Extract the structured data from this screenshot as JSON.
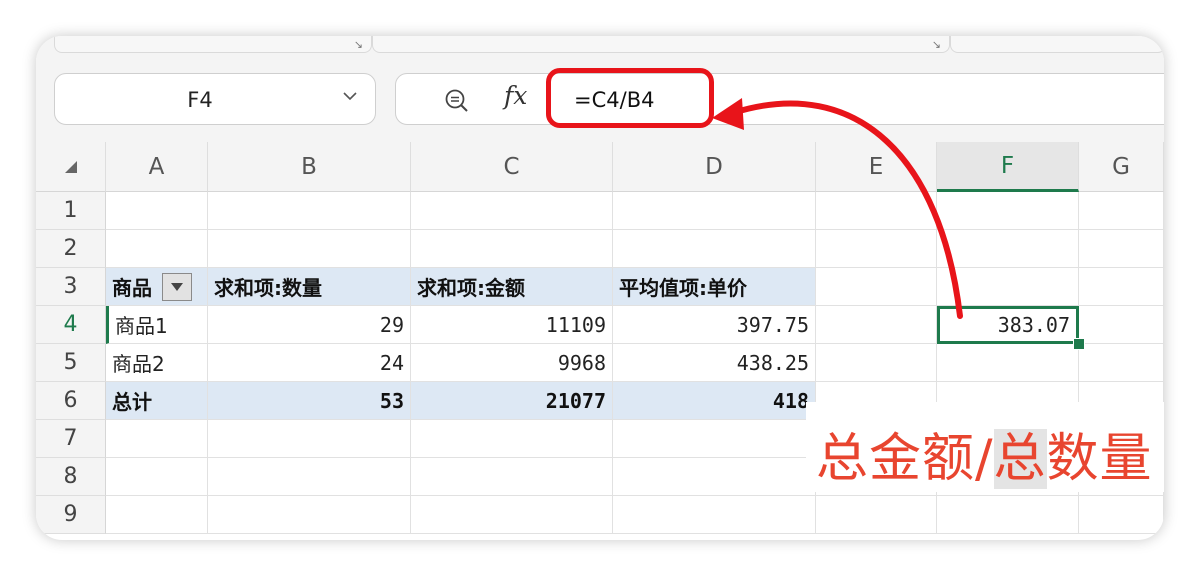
{
  "namebox": {
    "value": "F4"
  },
  "formula_bar": {
    "fx_label": "fx",
    "formula": "=C4/B4"
  },
  "columns": [
    "A",
    "B",
    "C",
    "D",
    "E",
    "F",
    "G"
  ],
  "rows": [
    "1",
    "2",
    "3",
    "4",
    "5",
    "6",
    "7",
    "8",
    "9"
  ],
  "pivot": {
    "headers": [
      "商品",
      "求和项:数量",
      "求和项:金额",
      "平均值项:单价"
    ],
    "rows": [
      [
        "商品1",
        "29",
        "11109",
        "397.75"
      ],
      [
        "商品2",
        "24",
        "9968",
        "438.25"
      ]
    ],
    "total": [
      "总计",
      "53",
      "21077",
      "418"
    ]
  },
  "active_cell": {
    "ref": "F4",
    "value": "383.07"
  },
  "annotation": {
    "text_before": "总金额/",
    "text_mark": "总",
    "text_after": "数量",
    "color": "#e8452f"
  },
  "colors": {
    "accent": "#1e7a4c",
    "highlight": "#e8141a",
    "pivot_fill": "#dde8f4"
  }
}
